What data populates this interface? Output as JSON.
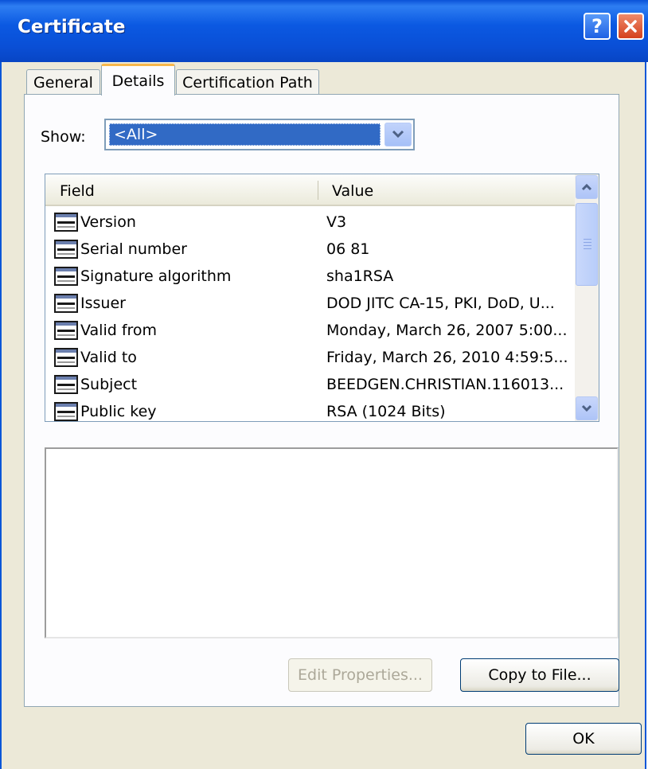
{
  "window": {
    "title": "Certificate",
    "help_symbol": "?",
    "tabs": [
      {
        "label": "General"
      },
      {
        "label": "Details"
      },
      {
        "label": "Certification Path"
      }
    ]
  },
  "details": {
    "show_label": "Show:",
    "show_value": "<All>",
    "columns": {
      "field": "Field",
      "value": "Value"
    },
    "rows": [
      {
        "field": "Version",
        "value": "V3"
      },
      {
        "field": "Serial number",
        "value": "06 81"
      },
      {
        "field": "Signature algorithm",
        "value": "sha1RSA"
      },
      {
        "field": "Issuer",
        "value": "DOD JITC CA-15, PKI, DoD, U..."
      },
      {
        "field": "Valid from",
        "value": "Monday, March 26, 2007 5:00..."
      },
      {
        "field": "Valid to",
        "value": "Friday, March 26, 2010 4:59:5..."
      },
      {
        "field": "Subject",
        "value": "BEEDGEN.CHRISTIAN.116013..."
      },
      {
        "field": "Public key",
        "value": "RSA (1024 Bits)"
      }
    ],
    "row_icon": "certificate-field-icon",
    "detail_text": "",
    "buttons": {
      "edit": "Edit Properties...",
      "copy": "Copy to File..."
    }
  },
  "footer": {
    "ok": "OK"
  },
  "colors": {
    "title_bar": "#0a4fd6",
    "selection": "#316ac5",
    "dialog_bg": "#ece9d8",
    "active_tab_accent": "#f7b74b"
  }
}
